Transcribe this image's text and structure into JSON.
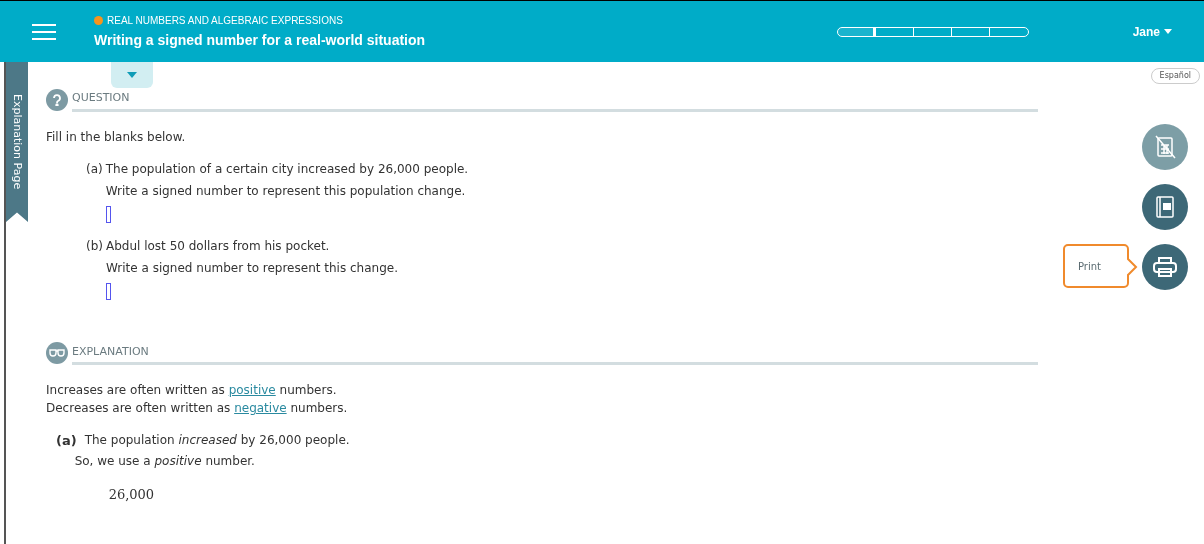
{
  "header": {
    "course": "REAL NUMBERS AND ALGEBRAIC EXPRESSIONS",
    "title": "Writing a signed number for a real-world situation",
    "progress": {
      "level": 0.2
    },
    "user": "Jane"
  },
  "side_tab": "Explanation Page",
  "language_button": "Español",
  "tools": [
    {
      "kind": "calculator",
      "disabled": true
    },
    {
      "kind": "dictionary",
      "disabled": false
    },
    {
      "kind": "print",
      "disabled": false,
      "tooltip": "Print"
    }
  ],
  "question": {
    "heading": "QUESTION",
    "instruction": "Fill in the blanks below.",
    "parts": [
      {
        "label": "(a)",
        "lines": [
          "The population of a certain city increased by 26,000 people.",
          "Write a signed number to represent this population change."
        ]
      },
      {
        "label": "(b)",
        "lines": [
          "Abdul lost 50 dollars from his pocket.",
          "Write a signed number to represent this change."
        ]
      }
    ]
  },
  "explanation": {
    "heading": "EXPLANATION",
    "lines": [
      {
        "before": "Increases are often written as ",
        "link": "positive",
        "after": " numbers."
      },
      {
        "before": "Decreases are often written as ",
        "link": "negative",
        "after": " numbers."
      }
    ],
    "parts": [
      {
        "label": "(a)",
        "lines": [
          "The population *increased* by 26,000 people.",
          "So, we use a *positive* number."
        ],
        "result": "26,000"
      }
    ]
  }
}
